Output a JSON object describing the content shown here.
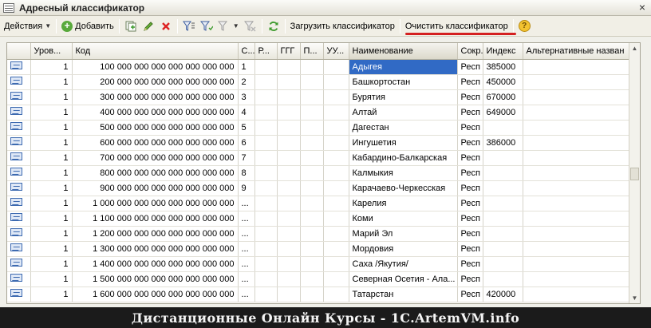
{
  "window": {
    "title": "Адресный классификатор",
    "close_glyph": "×"
  },
  "toolbar": {
    "actions_label": "Действия",
    "add_label": "Добавить",
    "load_label": "Загрузить классификатор",
    "clear_label": "Очистить классификатор",
    "help_glyph": "?"
  },
  "columns": {
    "level": "Уров...",
    "code": "Код",
    "c": "С...",
    "r": "Р...",
    "ggg": "ГГГ",
    "p": "П...",
    "uu": "УУ...",
    "name": "Наименование",
    "abbr": "Сокр.",
    "index": "Индекс",
    "alt": "Альтернативные назван"
  },
  "rows": [
    {
      "level": "1",
      "code": "100 000 000 000 000 000 000 000",
      "c": "1",
      "name": "Адыгея",
      "abbr": "Респ",
      "index": "385000"
    },
    {
      "level": "1",
      "code": "200 000 000 000 000 000 000 000",
      "c": "2",
      "name": "Башкортостан",
      "abbr": "Респ",
      "index": "450000"
    },
    {
      "level": "1",
      "code": "300 000 000 000 000 000 000 000",
      "c": "3",
      "name": "Бурятия",
      "abbr": "Респ",
      "index": "670000"
    },
    {
      "level": "1",
      "code": "400 000 000 000 000 000 000 000",
      "c": "4",
      "name": "Алтай",
      "abbr": "Респ",
      "index": "649000"
    },
    {
      "level": "1",
      "code": "500 000 000 000 000 000 000 000",
      "c": "5",
      "name": "Дагестан",
      "abbr": "Респ",
      "index": ""
    },
    {
      "level": "1",
      "code": "600 000 000 000 000 000 000 000",
      "c": "6",
      "name": "Ингушетия",
      "abbr": "Респ",
      "index": "386000"
    },
    {
      "level": "1",
      "code": "700 000 000 000 000 000 000 000",
      "c": "7",
      "name": "Кабардино-Балкарская",
      "abbr": "Респ",
      "index": ""
    },
    {
      "level": "1",
      "code": "800 000 000 000 000 000 000 000",
      "c": "8",
      "name": "Калмыкия",
      "abbr": "Респ",
      "index": ""
    },
    {
      "level": "1",
      "code": "900 000 000 000 000 000 000 000",
      "c": "9",
      "name": "Карачаево-Черкесская",
      "abbr": "Респ",
      "index": ""
    },
    {
      "level": "1",
      "code": "1 000 000 000 000 000 000 000 000",
      "c": "...",
      "name": "Карелия",
      "abbr": "Респ",
      "index": ""
    },
    {
      "level": "1",
      "code": "1 100 000 000 000 000 000 000 000",
      "c": "...",
      "name": "Коми",
      "abbr": "Респ",
      "index": ""
    },
    {
      "level": "1",
      "code": "1 200 000 000 000 000 000 000 000",
      "c": "...",
      "name": "Марий Эл",
      "abbr": "Респ",
      "index": ""
    },
    {
      "level": "1",
      "code": "1 300 000 000 000 000 000 000 000",
      "c": "...",
      "name": "Мордовия",
      "abbr": "Респ",
      "index": ""
    },
    {
      "level": "1",
      "code": "1 400 000 000 000 000 000 000 000",
      "c": "...",
      "name": "Саха /Якутия/",
      "abbr": "Респ",
      "index": ""
    },
    {
      "level": "1",
      "code": "1 500 000 000 000 000 000 000 000",
      "c": "...",
      "name": "Северная Осетия - Ала...",
      "abbr": "Респ",
      "index": ""
    },
    {
      "level": "1",
      "code": "1 600 000 000 000 000 000 000 000",
      "c": "...",
      "name": "Татарстан",
      "abbr": "Респ",
      "index": "420000"
    }
  ],
  "selected_row": 0,
  "banner": "Дистанционные Онлайн Курсы - 1C.ArtemVM.info"
}
